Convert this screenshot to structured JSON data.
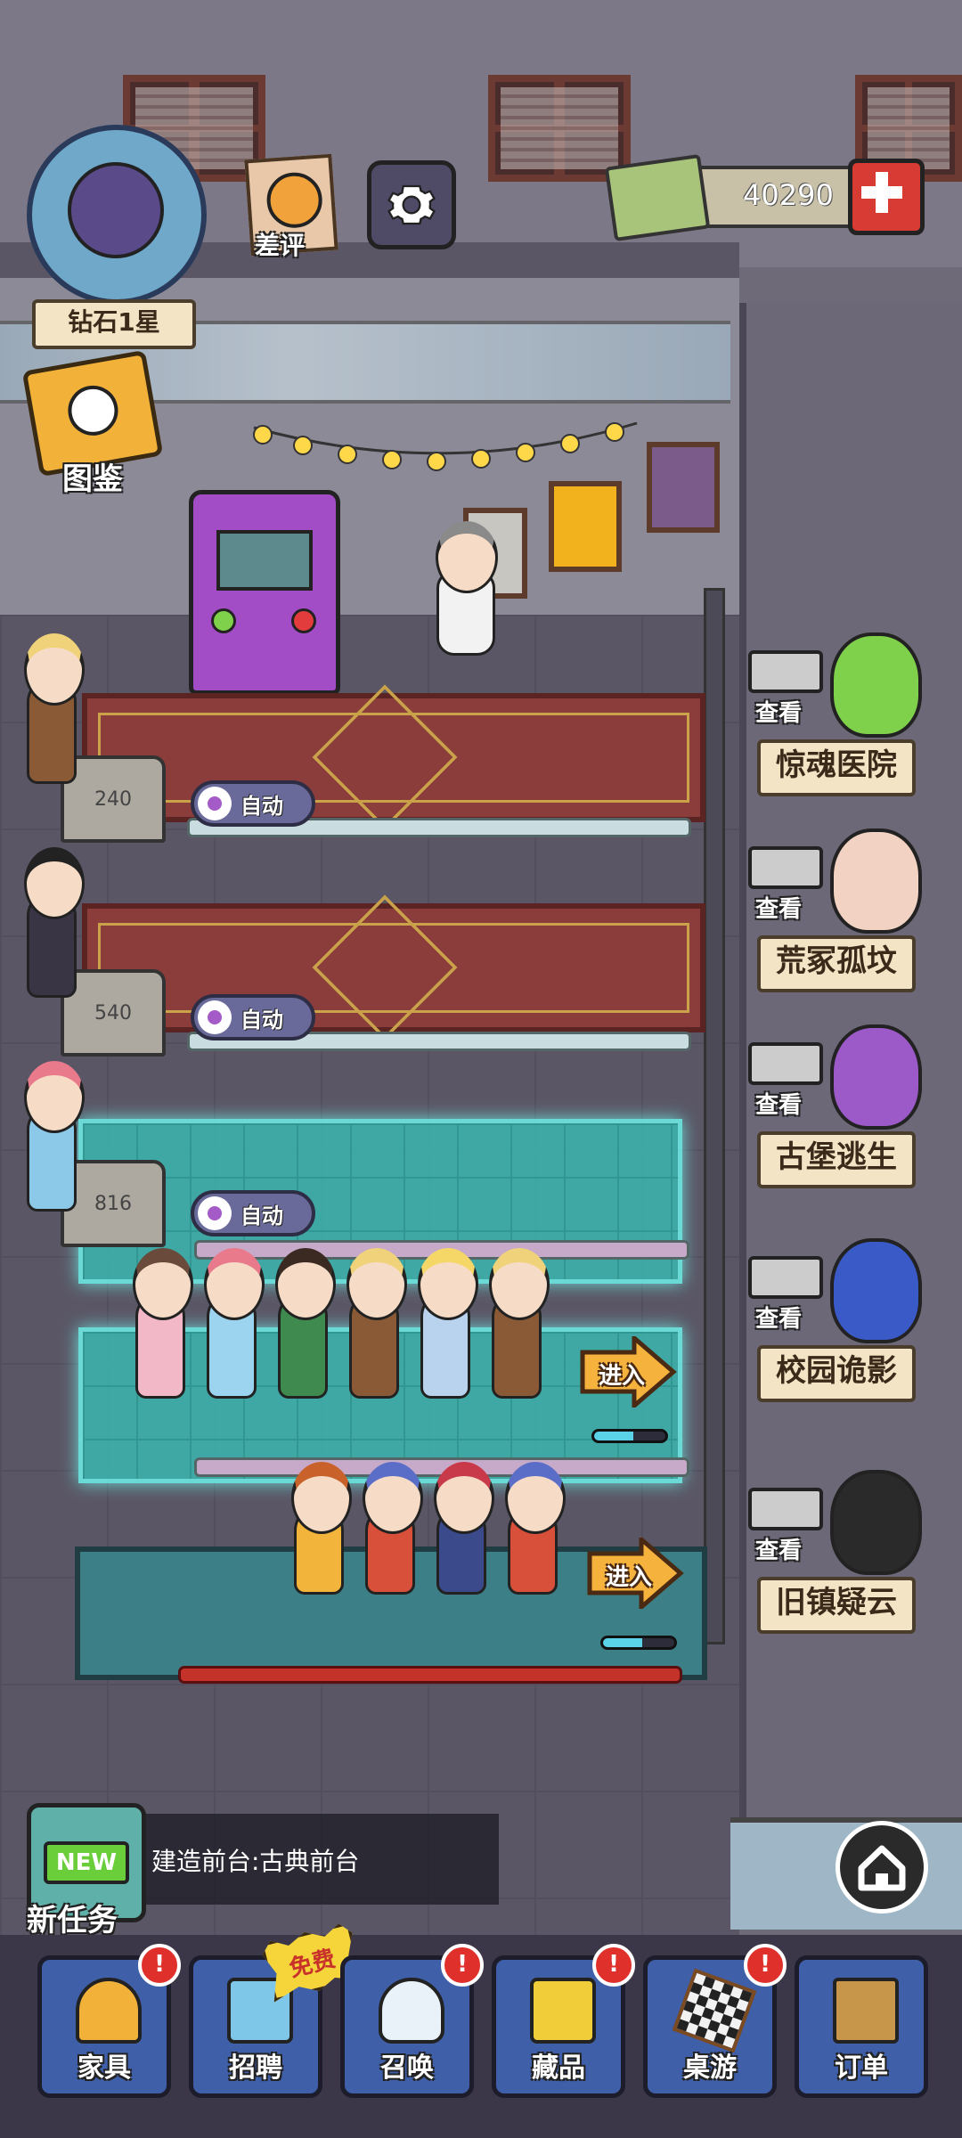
{
  "hud": {
    "rank_label": "钻石1星",
    "rating_label": "差评",
    "money": "40290",
    "collection_label": "图鉴"
  },
  "lanes": [
    {
      "tomb_value": "240",
      "auto_label": "自动"
    },
    {
      "tomb_value": "540",
      "auto_label": "自动"
    },
    {
      "tomb_value": "816",
      "auto_label": "自动"
    }
  ],
  "queues": [
    {
      "enter_label": "进入",
      "progress": 0.55
    },
    {
      "enter_label": "进入",
      "progress": 0.55
    }
  ],
  "rooms": [
    {
      "view_label": "查看",
      "name": "惊魂医院"
    },
    {
      "view_label": "查看",
      "name": "荒冢孤坟"
    },
    {
      "view_label": "查看",
      "name": "古堡逃生"
    },
    {
      "view_label": "查看",
      "name": "校园诡影"
    },
    {
      "view_label": "查看",
      "name": "旧镇疑云"
    }
  ],
  "task": {
    "new_badge": "NEW",
    "label": "新任务",
    "text": "建造前台:古典前台"
  },
  "nav": {
    "free_badge": "免费",
    "items": [
      {
        "label": "家具",
        "icon": "furniture-icon",
        "alert": "!"
      },
      {
        "label": "招聘",
        "icon": "recruit-icon",
        "alert": ""
      },
      {
        "label": "召唤",
        "icon": "ghost-icon",
        "alert": "!"
      },
      {
        "label": "藏品",
        "icon": "safe-icon",
        "alert": "!"
      },
      {
        "label": "桌游",
        "icon": "chess-icon",
        "alert": "!"
      },
      {
        "label": "订单",
        "icon": "bat-box-icon",
        "alert": ""
      }
    ]
  },
  "colors": {
    "accent_red": "#e0302c",
    "teal_zone": "#3bb7b0",
    "nav_blue": "#3f5fa8"
  }
}
